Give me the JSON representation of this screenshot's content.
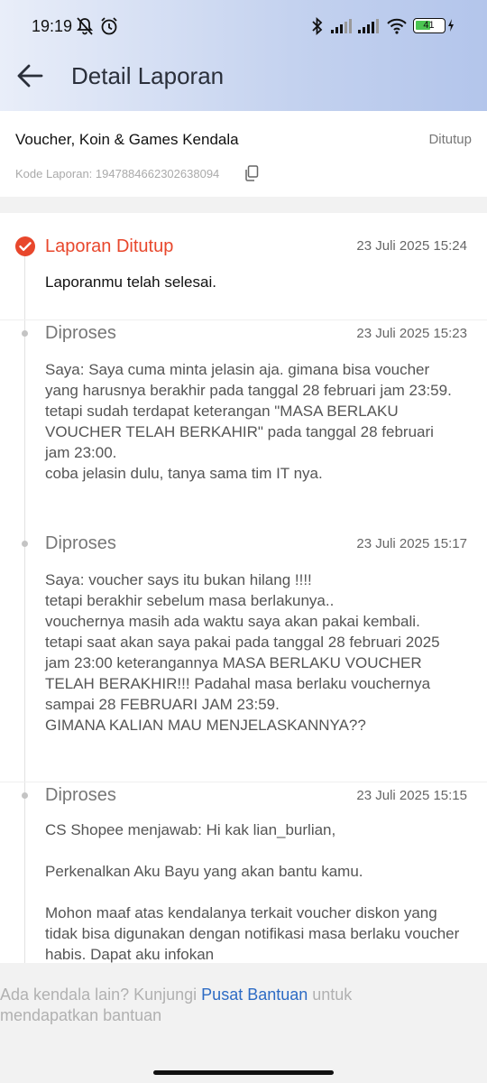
{
  "status_bar": {
    "time": "19:19",
    "battery": "41"
  },
  "app_bar": {
    "title": "Detail Laporan"
  },
  "summary": {
    "title": "Voucher, Koin & Games Kendala",
    "status": "Ditutup",
    "code": "Kode Laporan: 1947884662302638094"
  },
  "timeline": [
    {
      "title": "Laporan Ditutup",
      "date": "23 Juli 2025 15:24",
      "body": "Laporanmu telah selesai."
    },
    {
      "title": "Diproses",
      "date": "23 Juli 2025 15:23",
      "body": "Saya: Saya cuma minta jelasin aja. gimana bisa voucher yang harusnya berakhir pada tanggal 28 februari jam 23:59.\ntetapi sudah terdapat keterangan \"MASA BERLAKU VOUCHER TELAH BERKAHIR\" pada tanggal 28 februari jam 23:00.\ncoba jelasin dulu, tanya sama tim IT nya."
    },
    {
      "title": "Diproses",
      "date": "23 Juli 2025 15:17",
      "body": "Saya: voucher says itu bukan hilang !!!!\ntetapi berakhir sebelum masa berlakunya..\nvouchernya masih ada waktu saya akan pakai kembali.\ntetapi saat akan saya pakai pada tanggal 28 februari 2025 jam 23:00 keterangannya MASA BERLAKU VOUCHER TELAH BERAKHIR!!! Padahal masa berlaku vouchernya sampai 28 FEBRUARI JAM 23:59.\nGIMANA KALIAN MAU MENJELASKANNYA??"
    },
    {
      "title": "Diproses",
      "date": "23 Juli 2025 15:15",
      "body": "CS Shopee menjawab: Hi kak lian_burlian,\n\nPerkenalkan Aku Bayu yang akan bantu kamu.\n\nMohon maaf atas kendalanya terkait voucher diskon yang tidak bisa digunakan dengan notifikasi masa berlaku voucher habis. Dapat aku infokan"
    }
  ],
  "footer": {
    "text_before": "Ada kendala lain? Kunjungi ",
    "link": "Pusat Bantuan",
    "text_after": " untuk mendapatkan bantuan"
  }
}
